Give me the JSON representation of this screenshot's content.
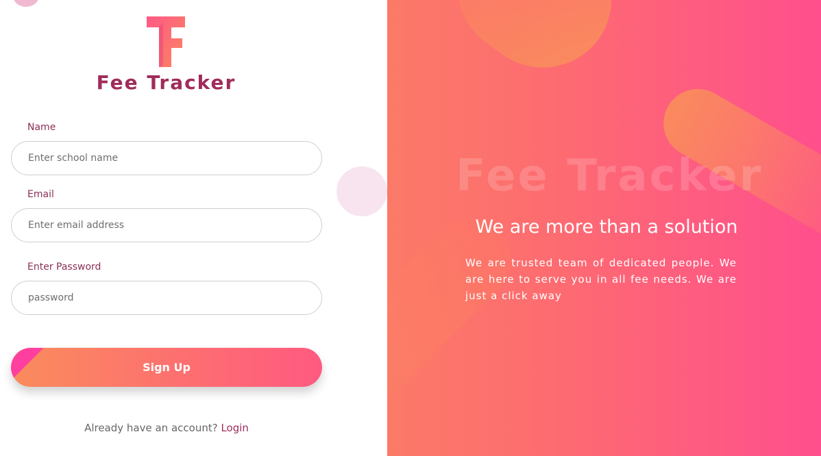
{
  "brand": {
    "name": "Fee Tracker",
    "logo_letter": "F",
    "colors": {
      "brand_text": "#a02c5a",
      "gradient_start": "#fa8c5c",
      "gradient_end": "#ff4f8d"
    }
  },
  "form": {
    "name_label": "Name",
    "name_placeholder": "Enter school name",
    "email_label": "Email",
    "email_placeholder": "Enter email address",
    "password_label": "Enter Password",
    "password_placeholder": "password",
    "signup_label": "Sign  Up",
    "login_prompt": "Already have an account?",
    "login_link": "Login"
  },
  "hero": {
    "watermark_title": "Fee Tracker",
    "subtitle": "We are more than a solution",
    "body": "We are trusted team of dedicated people. We are here to serve you in all fee needs. We are just a click away"
  }
}
